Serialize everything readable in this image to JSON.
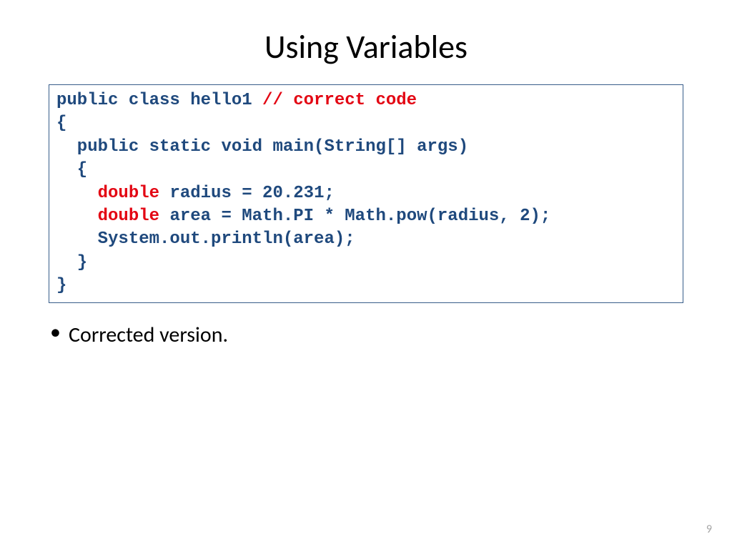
{
  "title": "Using Variables",
  "code": {
    "line1a": "public class hello1 ",
    "line1b": "// correct code",
    "line2": "{",
    "line3": "  public static void main(String[] args)",
    "line4": "  {",
    "line5a": "    ",
    "line5b": "double ",
    "line5c": "radius = 20.231;",
    "line6a": "    ",
    "line6b": "double ",
    "line6c": "area = Math.PI * Math.pow(radius, 2);",
    "line7": "    System.out.println(area);",
    "line8": "  }",
    "line9": "}"
  },
  "bullet1": "Corrected version.",
  "pageNumber": "9"
}
